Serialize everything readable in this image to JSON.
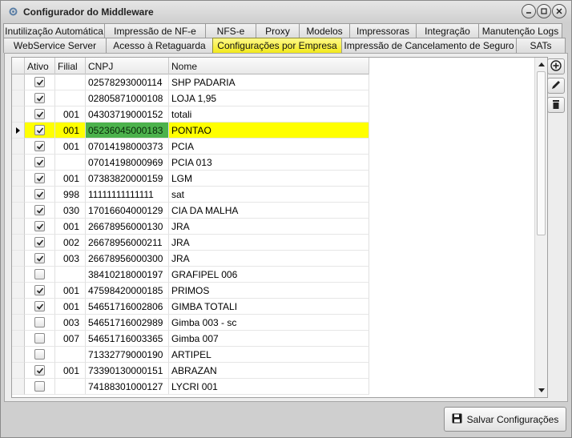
{
  "window": {
    "title": "Configurador do Middleware",
    "controls": [
      "minimize-icon",
      "maximize-icon",
      "close-icon"
    ]
  },
  "tabs_row1": [
    {
      "label": "Inutilização Automática"
    },
    {
      "label": "Impressão de NF-e"
    },
    {
      "label": "NFS-e"
    },
    {
      "label": "Proxy"
    },
    {
      "label": "Modelos"
    },
    {
      "label": "Impressoras"
    },
    {
      "label": "Integração"
    },
    {
      "label": "Manutenção Logs"
    }
  ],
  "tabs_row2": [
    {
      "label": "WebService Server"
    },
    {
      "label": "Acesso à Retaguarda"
    },
    {
      "label": "Configurações por Empresa",
      "active": true
    },
    {
      "label": "Impressão de Cancelamento de Seguro"
    },
    {
      "label": "SATs"
    }
  ],
  "grid": {
    "columns": [
      "Ativo",
      "Filial",
      "CNPJ",
      "Nome"
    ],
    "rows": [
      {
        "ativo": true,
        "filial": "",
        "cnpj": "02578293000114",
        "nome": "SHP PADARIA"
      },
      {
        "ativo": true,
        "filial": "",
        "cnpj": "02805871000108",
        "nome": "LOJA 1,95"
      },
      {
        "ativo": true,
        "filial": "001",
        "cnpj": "04303719000152",
        "nome": "totali"
      },
      {
        "ativo": true,
        "filial": "001",
        "cnpj": "05236045000183",
        "nome": "PONTAO",
        "selected": true
      },
      {
        "ativo": true,
        "filial": "001",
        "cnpj": "07014198000373",
        "nome": "PCIA"
      },
      {
        "ativo": true,
        "filial": "",
        "cnpj": "07014198000969",
        "nome": "PCIA 013"
      },
      {
        "ativo": true,
        "filial": "001",
        "cnpj": "07383820000159",
        "nome": "LGM"
      },
      {
        "ativo": true,
        "filial": "998",
        "cnpj": "11111111111111",
        "nome": "sat"
      },
      {
        "ativo": true,
        "filial": "030",
        "cnpj": "17016604000129",
        "nome": "CIA DA MALHA"
      },
      {
        "ativo": true,
        "filial": "001",
        "cnpj": "26678956000130",
        "nome": "JRA"
      },
      {
        "ativo": true,
        "filial": "002",
        "cnpj": "26678956000211",
        "nome": "JRA"
      },
      {
        "ativo": true,
        "filial": "003",
        "cnpj": "26678956000300",
        "nome": "JRA"
      },
      {
        "ativo": false,
        "filial": "",
        "cnpj": "38410218000197",
        "nome": "GRAFIPEL 006"
      },
      {
        "ativo": true,
        "filial": "001",
        "cnpj": "47598420000185",
        "nome": "PRIMOS"
      },
      {
        "ativo": true,
        "filial": "001",
        "cnpj": "54651716002806",
        "nome": "GIMBA TOTALI"
      },
      {
        "ativo": false,
        "filial": "003",
        "cnpj": "54651716002989",
        "nome": "Gimba 003 - sc"
      },
      {
        "ativo": false,
        "filial": "007",
        "cnpj": "54651716003365",
        "nome": "Gimba 007"
      },
      {
        "ativo": false,
        "filial": "",
        "cnpj": "71332779000190",
        "nome": "ARTIPEL"
      },
      {
        "ativo": true,
        "filial": "001",
        "cnpj": "73390130000151",
        "nome": "ABRAZAN"
      },
      {
        "ativo": false,
        "filial": "",
        "cnpj": "74188301000127",
        "nome": "LYCRI 001"
      }
    ]
  },
  "side_buttons": [
    "add-icon",
    "edit-icon",
    "delete-icon"
  ],
  "footer": {
    "save_label": "Salvar Configurações",
    "save_icon": "save-icon"
  },
  "colors": {
    "active_tab": "#f3ea1c",
    "selected_row": "#ffff00",
    "selected_cell": "#4cb24c"
  }
}
